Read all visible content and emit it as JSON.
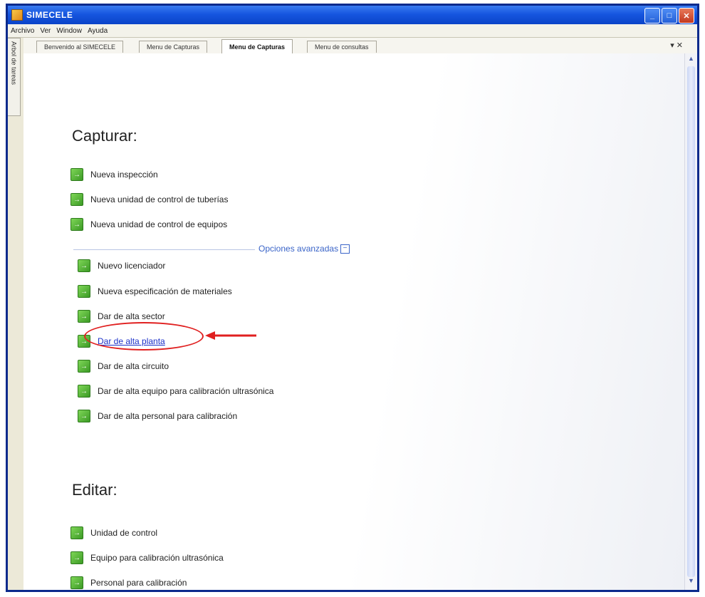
{
  "window": {
    "title": "SIMECELE",
    "buttons": [
      "_",
      "□",
      "✕"
    ]
  },
  "menubar": [
    "Archivo",
    "Ver",
    "Window",
    "Ayuda"
  ],
  "side_tab": "Arbol de tareas",
  "tabs": [
    {
      "label": "Benvenido al SIMECELE",
      "active": false
    },
    {
      "label": "Menu de Capturas",
      "active": false
    },
    {
      "label": "Menu de Capturas",
      "active": true
    },
    {
      "label": "Menu de consultas",
      "active": false
    }
  ],
  "tab_controls": "▾ ✕",
  "capturar": {
    "title": "Capturar:",
    "items": [
      "Nueva inspección",
      "Nueva unidad de control de tuberías",
      "Nueva unidad de control de equipos"
    ]
  },
  "advanced": {
    "label": "Opciones avanzadas",
    "toggle": "−",
    "items": [
      {
        "label": "Nuevo licenciador",
        "link": false
      },
      {
        "label": "Nueva especificación de materiales",
        "link": false
      },
      {
        "label": "Dar de alta sector",
        "link": false
      },
      {
        "label": "Dar de alta planta",
        "link": true
      },
      {
        "label": "Dar de alta circuito",
        "link": false
      },
      {
        "label": "Dar de alta equipo para calibración ultrasónica",
        "link": false
      },
      {
        "label": "Dar de alta personal para calibración",
        "link": false
      }
    ]
  },
  "editar": {
    "title": "Editar:",
    "items": [
      "Unidad de control",
      "Equipo para calibración ultrasónica",
      "Personal para calibración"
    ]
  },
  "icon_glyph": "→",
  "colors": {
    "link": "#1a2fc8",
    "highlight": "#e02020",
    "titlebar": "#1656e0"
  }
}
